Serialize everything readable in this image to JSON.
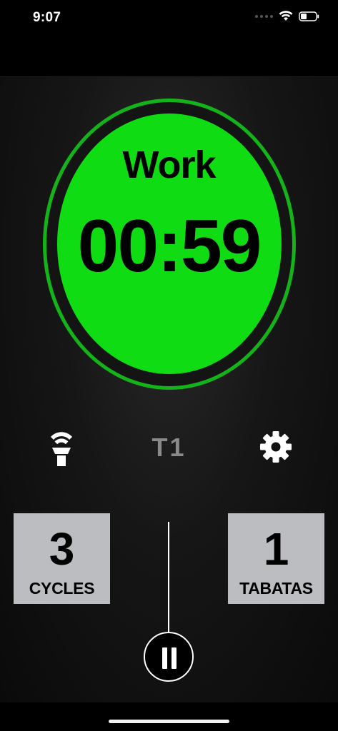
{
  "status_bar": {
    "time": "9:07",
    "icons": [
      "cellular-dots-icon",
      "wifi-icon",
      "battery-icon"
    ]
  },
  "timer": {
    "phase": "Work",
    "countdown": "00:59",
    "colors": {
      "active": "#0fdc12",
      "ring": "#14b31a"
    }
  },
  "controls": {
    "light_icon": "flashlight-icon",
    "preset": "T1",
    "settings_icon": "gear-icon",
    "pause_icon": "pause-icon"
  },
  "counters": {
    "cycles": {
      "value": "3",
      "label": "CYCLES"
    },
    "tabatas": {
      "value": "1",
      "label": "TABATAS"
    }
  }
}
